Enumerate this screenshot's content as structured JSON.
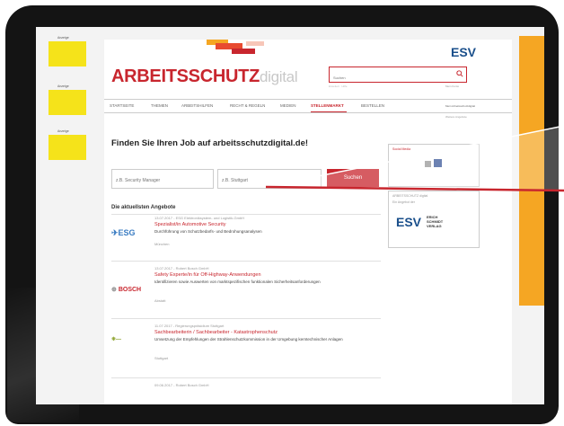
{
  "ads": {
    "label": "Anzeige"
  },
  "brand": {
    "main": "ARBEITSSCHUTZ",
    "sub": "digital"
  },
  "header": {
    "esv_logo": "ESV",
    "search_placeholder": "Suchen",
    "search_hint": "Erweitert · Hilfe",
    "login": "Mein Konto"
  },
  "nav": {
    "items": [
      "STARTSEITE",
      "THEMEN",
      "ARBEITSHILFEN",
      "RECHT & REGELN",
      "MEDIEN",
      "STELLENMARKT",
      "BESTELLEN"
    ],
    "active_index": 5,
    "right_top": "Mein Arbeitsschutzdigital",
    "right_bottom": "Weitere Angebote"
  },
  "main": {
    "headline": "Finden Sie Ihren Job auf arbeitsschutzdigital.de!",
    "job_placeholder": "z.B. Security Manager",
    "location_placeholder": "z.B. Stuttgart",
    "search_button": "Suchen",
    "section_title": "Die aktuellsten Angebote"
  },
  "jobs": [
    {
      "logo": "ESG",
      "meta": "13.07.2017 - ESG Elektroniksystem- und Logistik-GmbH",
      "title": "Spezialist/in Automotive Security",
      "desc": "Durchführung von Schutzbedarfs- und Bedrohungsanalysen",
      "loc": "München"
    },
    {
      "logo": "BOSCH",
      "meta": "13.07.2017 - Robert Bosch GmbH",
      "title": "Safety Experte/in für Off-Highway-Anwendungen",
      "desc": "Identifizieren sowie Auswerten von marktspezifischen funktionalen Sicherheitsanforderungen",
      "loc": "Abstatt"
    },
    {
      "logo": "",
      "meta": "11.07.2017 - Regierungspräsidium Stuttgart",
      "title": "Sachbearbeiterin / Sachbearbeiter - Katastrophenschutz",
      "desc": "Umsetzung der Empfehlungen der Strahlenschutzkommission in der Umgebung kerntechnischer Anlagen",
      "loc": "Stuttgart"
    },
    {
      "logo": "",
      "meta": "09.06.2017 - Robert Bosch GmbH",
      "title": "",
      "desc": "",
      "loc": ""
    }
  ],
  "sidebar": {
    "social_title": "Social Media",
    "publisher_title": "ARBEITSSCHUTZ digital",
    "publisher_sub": "Ein Angebot der",
    "esv_main": "ESV",
    "esv_line1": "ERICH",
    "esv_line2": "SCHMIDT",
    "esv_line3": "VERLAG"
  },
  "colors": {
    "accent": "#c8262e",
    "ad_yellow": "#f5e31a",
    "side_orange": "#f5a623",
    "esv_blue": "#1a4f8b"
  }
}
